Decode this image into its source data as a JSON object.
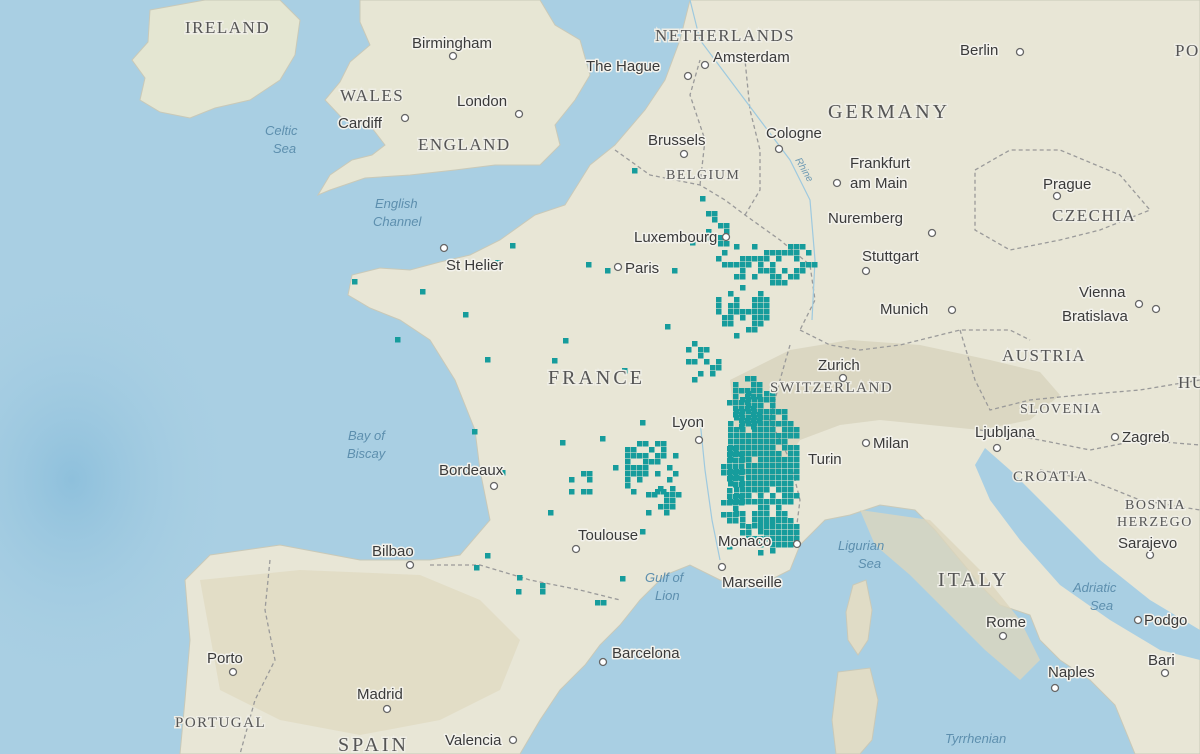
{
  "map": {
    "colors": {
      "ocean": "#a9cfe3",
      "land": "#e8e6d6",
      "land_dark": "#ddd7bf",
      "border": "#9a9a9a",
      "occurrence": "#169c9c"
    },
    "country_labels": [
      {
        "id": "ireland",
        "label": "IRELAND"
      },
      {
        "id": "wales",
        "label": "WALES"
      },
      {
        "id": "england",
        "label": "ENGLAND"
      },
      {
        "id": "netherlands",
        "label": "NETHERLANDS"
      },
      {
        "id": "belgium",
        "label": "BELGIUM"
      },
      {
        "id": "germany",
        "label": "GERMANY"
      },
      {
        "id": "czechia",
        "label": "CZECHIA"
      },
      {
        "id": "austria",
        "label": "AUSTRIA"
      },
      {
        "id": "switzerland",
        "label": "SWITZERLAND"
      },
      {
        "id": "france",
        "label": "FRANCE"
      },
      {
        "id": "slovenia",
        "label": "SLOVENIA"
      },
      {
        "id": "croatia",
        "label": "CROATIA"
      },
      {
        "id": "bosnia1",
        "label": "BOSNIA"
      },
      {
        "id": "bosnia2",
        "label": "HERZEGO"
      },
      {
        "id": "italy",
        "label": "ITALY"
      },
      {
        "id": "portugal",
        "label": "PORTUGAL"
      },
      {
        "id": "spain",
        "label": "SPAIN"
      },
      {
        "id": "po",
        "label": "PO"
      },
      {
        "id": "hu",
        "label": "HU"
      }
    ],
    "sea_labels": [
      {
        "id": "celtic1",
        "label": "Celtic"
      },
      {
        "id": "celtic2",
        "label": "Sea"
      },
      {
        "id": "english1",
        "label": "English"
      },
      {
        "id": "english2",
        "label": "Channel"
      },
      {
        "id": "biscay1",
        "label": "Bay of"
      },
      {
        "id": "biscay2",
        "label": "Biscay"
      },
      {
        "id": "lion1",
        "label": "Gulf of"
      },
      {
        "id": "lion2",
        "label": "Lion"
      },
      {
        "id": "ligurian1",
        "label": "Ligurian"
      },
      {
        "id": "ligurian2",
        "label": "Sea"
      },
      {
        "id": "adriatic1",
        "label": "Adriatic"
      },
      {
        "id": "adriatic2",
        "label": "Sea"
      },
      {
        "id": "tyrrhenian",
        "label": "Tyrrhenian"
      },
      {
        "id": "rhine",
        "label": "Rhine"
      }
    ],
    "cities": [
      {
        "id": "birmingham",
        "label": "Birmingham"
      },
      {
        "id": "london",
        "label": "London"
      },
      {
        "id": "cardiff",
        "label": "Cardiff"
      },
      {
        "id": "thehague",
        "label": "The Hague"
      },
      {
        "id": "amsterdam",
        "label": "Amsterdam"
      },
      {
        "id": "berlin",
        "label": "Berlin"
      },
      {
        "id": "brussels",
        "label": "Brussels"
      },
      {
        "id": "cologne",
        "label": "Cologne"
      },
      {
        "id": "frankfurt1",
        "label": "Frankfurt"
      },
      {
        "id": "frankfurt2",
        "label": "am Main"
      },
      {
        "id": "prague",
        "label": "Prague"
      },
      {
        "id": "nuremberg",
        "label": "Nuremberg"
      },
      {
        "id": "luxembourg",
        "label": "Luxembourg"
      },
      {
        "id": "stuttgart",
        "label": "Stuttgart"
      },
      {
        "id": "sthelier",
        "label": "St Helier"
      },
      {
        "id": "paris",
        "label": "Paris"
      },
      {
        "id": "vienna",
        "label": "Vienna"
      },
      {
        "id": "bratislava",
        "label": "Bratislava"
      },
      {
        "id": "munich",
        "label": "Munich"
      },
      {
        "id": "zurich",
        "label": "Zurich"
      },
      {
        "id": "lyon",
        "label": "Lyon"
      },
      {
        "id": "milan",
        "label": "Milan"
      },
      {
        "id": "ljubljana",
        "label": "Ljubljana"
      },
      {
        "id": "zagreb",
        "label": "Zagreb"
      },
      {
        "id": "turin",
        "label": "Turin"
      },
      {
        "id": "bordeaux",
        "label": "Bordeaux"
      },
      {
        "id": "toulouse",
        "label": "Toulouse"
      },
      {
        "id": "monaco",
        "label": "Monaco"
      },
      {
        "id": "sarajevo",
        "label": "Sarajevo"
      },
      {
        "id": "bilbao",
        "label": "Bilbao"
      },
      {
        "id": "marseille",
        "label": "Marseille"
      },
      {
        "id": "porto",
        "label": "Porto"
      },
      {
        "id": "barcelona",
        "label": "Barcelona"
      },
      {
        "id": "rome",
        "label": "Rome"
      },
      {
        "id": "podgorica",
        "label": "Podgo"
      },
      {
        "id": "bari",
        "label": "Bari"
      },
      {
        "id": "madrid",
        "label": "Madrid"
      },
      {
        "id": "naples",
        "label": "Naples"
      },
      {
        "id": "valencia",
        "label": "Valencia"
      }
    ]
  }
}
